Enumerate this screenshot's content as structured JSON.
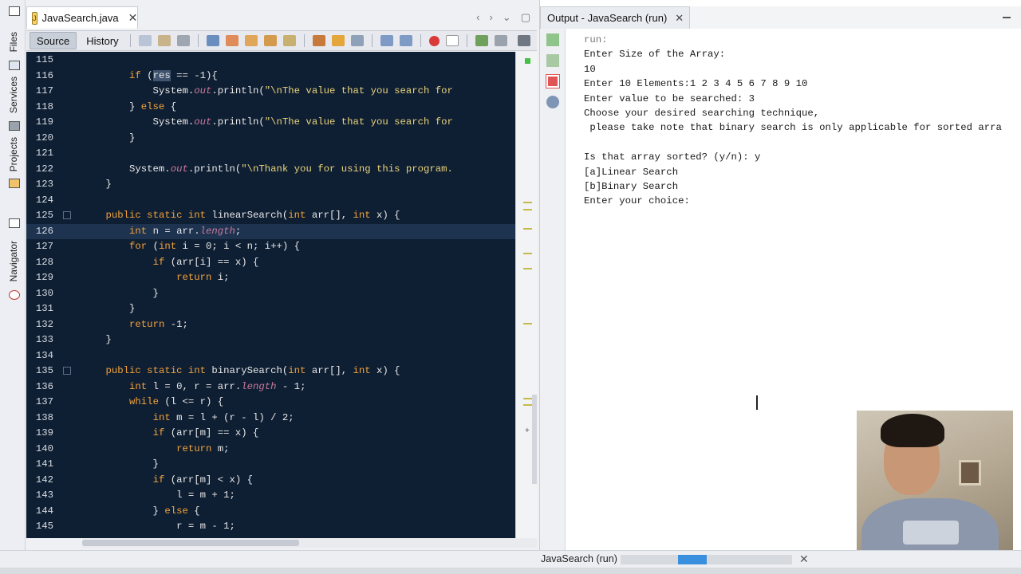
{
  "side_bar": {
    "tabs": [
      "Files",
      "Services",
      "Projects",
      "Navigator"
    ]
  },
  "editor": {
    "tab_title": "JavaSearch.java",
    "file_icon_label": "J",
    "close_glyph": "✕",
    "toolbar": {
      "source_label": "Source",
      "history_label": "History"
    }
  },
  "lines": [
    {
      "n": "115",
      "fold": false,
      "parts": []
    },
    {
      "n": "116",
      "fold": false,
      "parts": [
        [
          "",
          "        "
        ],
        [
          "kw",
          "if"
        ],
        [
          "",
          " ("
        ],
        [
          "hl",
          "res"
        ],
        [
          "",
          " == -1){"
        ]
      ]
    },
    {
      "n": "117",
      "fold": false,
      "parts": [
        [
          "",
          "            System."
        ],
        [
          "fld",
          "out"
        ],
        [
          "",
          ".println("
        ],
        [
          "str",
          "\"\\nThe value that you search for"
        ]
      ]
    },
    {
      "n": "118",
      "fold": false,
      "parts": [
        [
          "",
          "        } "
        ],
        [
          "kw",
          "else"
        ],
        [
          "",
          " {"
        ]
      ]
    },
    {
      "n": "119",
      "fold": false,
      "parts": [
        [
          "",
          "            System."
        ],
        [
          "fld",
          "out"
        ],
        [
          "",
          ".println("
        ],
        [
          "str",
          "\"\\nThe value that you search for"
        ]
      ]
    },
    {
      "n": "120",
      "fold": false,
      "parts": [
        [
          "",
          "        }"
        ]
      ]
    },
    {
      "n": "121",
      "fold": false,
      "parts": []
    },
    {
      "n": "122",
      "fold": false,
      "parts": [
        [
          "",
          "        System."
        ],
        [
          "fld",
          "out"
        ],
        [
          "",
          ".println("
        ],
        [
          "str",
          "\"\\nThank you for using this program."
        ]
      ]
    },
    {
      "n": "123",
      "fold": false,
      "parts": [
        [
          "",
          "    }"
        ]
      ]
    },
    {
      "n": "124",
      "fold": false,
      "parts": []
    },
    {
      "n": "125",
      "fold": true,
      "parts": [
        [
          "",
          "    "
        ],
        [
          "kw",
          "public static int"
        ],
        [
          "",
          " linearSearch("
        ],
        [
          "kw",
          "int"
        ],
        [
          "",
          " arr[], "
        ],
        [
          "kw",
          "int"
        ],
        [
          "",
          " x) {"
        ]
      ]
    },
    {
      "n": "126",
      "fold": false,
      "current": true,
      "parts": [
        [
          "",
          "        "
        ],
        [
          "kw",
          "int"
        ],
        [
          "",
          " n = arr."
        ],
        [
          "fld",
          "length"
        ],
        [
          "",
          ";"
        ]
      ]
    },
    {
      "n": "127",
      "fold": false,
      "parts": [
        [
          "",
          "        "
        ],
        [
          "kw",
          "for"
        ],
        [
          "",
          " ("
        ],
        [
          "kw",
          "int"
        ],
        [
          "",
          " i = 0; i < n; i++) {"
        ]
      ]
    },
    {
      "n": "128",
      "fold": false,
      "parts": [
        [
          "",
          "            "
        ],
        [
          "kw",
          "if"
        ],
        [
          "",
          " (arr[i] == x) {"
        ]
      ]
    },
    {
      "n": "129",
      "fold": false,
      "parts": [
        [
          "",
          "                "
        ],
        [
          "kw",
          "return"
        ],
        [
          "",
          " i;"
        ]
      ]
    },
    {
      "n": "130",
      "fold": false,
      "parts": [
        [
          "",
          "            }"
        ]
      ]
    },
    {
      "n": "131",
      "fold": false,
      "parts": [
        [
          "",
          "        }"
        ]
      ]
    },
    {
      "n": "132",
      "fold": false,
      "parts": [
        [
          "",
          "        "
        ],
        [
          "kw",
          "return"
        ],
        [
          "",
          " -1;"
        ]
      ]
    },
    {
      "n": "133",
      "fold": false,
      "parts": [
        [
          "",
          "    }"
        ]
      ]
    },
    {
      "n": "134",
      "fold": false,
      "parts": []
    },
    {
      "n": "135",
      "fold": true,
      "parts": [
        [
          "",
          "    "
        ],
        [
          "kw",
          "public static int"
        ],
        [
          "",
          " binarySearch("
        ],
        [
          "kw",
          "int"
        ],
        [
          "",
          " arr[], "
        ],
        [
          "kw",
          "int"
        ],
        [
          "",
          " x) {"
        ]
      ]
    },
    {
      "n": "136",
      "fold": false,
      "parts": [
        [
          "",
          "        "
        ],
        [
          "kw",
          "int"
        ],
        [
          "",
          " l = 0, r = arr."
        ],
        [
          "fld",
          "length"
        ],
        [
          "",
          " - 1;"
        ]
      ]
    },
    {
      "n": "137",
      "fold": false,
      "parts": [
        [
          "",
          "        "
        ],
        [
          "kw",
          "while"
        ],
        [
          "",
          " (l <= r) {"
        ]
      ]
    },
    {
      "n": "138",
      "fold": false,
      "parts": [
        [
          "",
          "            "
        ],
        [
          "kw",
          "int"
        ],
        [
          "",
          " m = l + (r - l) / 2;"
        ]
      ]
    },
    {
      "n": "139",
      "fold": false,
      "parts": [
        [
          "",
          "            "
        ],
        [
          "kw",
          "if"
        ],
        [
          "",
          " (arr[m] == x) {"
        ]
      ]
    },
    {
      "n": "140",
      "fold": false,
      "parts": [
        [
          "",
          "                "
        ],
        [
          "kw",
          "return"
        ],
        [
          "",
          " m;"
        ]
      ]
    },
    {
      "n": "141",
      "fold": false,
      "parts": [
        [
          "",
          "            }"
        ]
      ]
    },
    {
      "n": "142",
      "fold": false,
      "parts": [
        [
          "",
          "            "
        ],
        [
          "kw",
          "if"
        ],
        [
          "",
          " (arr[m] < x) {"
        ]
      ]
    },
    {
      "n": "143",
      "fold": false,
      "parts": [
        [
          "",
          "                l = m + 1;"
        ]
      ]
    },
    {
      "n": "144",
      "fold": false,
      "parts": [
        [
          "",
          "            } "
        ],
        [
          "kw",
          "else"
        ],
        [
          "",
          " {"
        ]
      ]
    },
    {
      "n": "145",
      "fold": false,
      "parts": [
        [
          "",
          "                r = m - 1;"
        ]
      ]
    }
  ],
  "output": {
    "tab_title": "Output - JavaSearch (run)",
    "close_glyph": "✕",
    "console_lines": [
      "run:",
      "Enter Size of the Array:",
      "10",
      "Enter 10 Elements:1 2 3 4 5 6 7 8 9 10",
      "Enter value to be searched: 3",
      "Choose your desired searching technique,",
      " please take note that binary search is only applicable for sorted arra",
      "",
      "Is that array sorted? (y/n): y",
      "[a]Linear Search",
      "[b]Binary Search",
      "Enter your choice:"
    ]
  },
  "status_bar": {
    "label": "JavaSearch (run)",
    "progress": 0.4,
    "close_glyph": "✕"
  },
  "colors": {
    "keyword": "#f2a23a",
    "string": "#e8d27a",
    "field": "#c97a9d",
    "editor_bg": "#0f1f33",
    "progress": "#3a8fde"
  }
}
